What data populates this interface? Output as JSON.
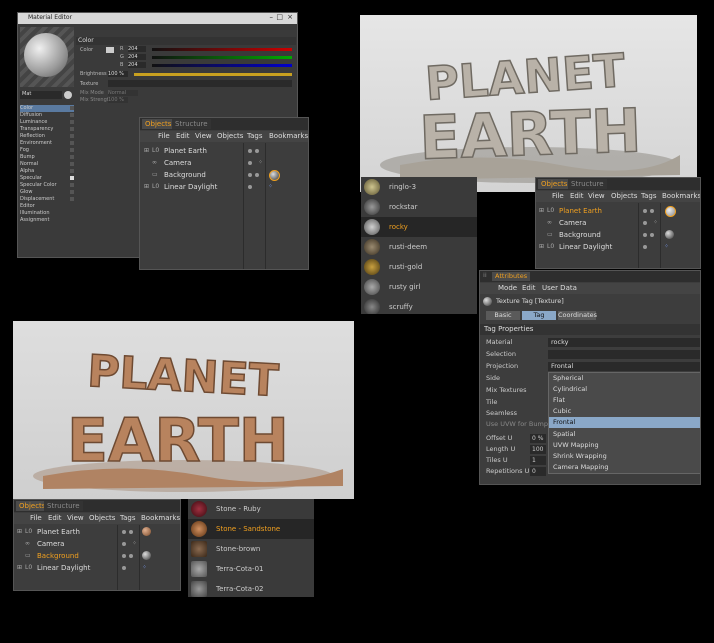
{
  "material_editor": {
    "title": "Material Editor",
    "section_title": "Color",
    "color_label": "Color",
    "channel_labels": [
      "R",
      "G",
      "B"
    ],
    "channel_values": [
      "204",
      "204",
      "204"
    ],
    "brightness_label": "Brightness",
    "brightness_value": "100 %",
    "texture_label": "Texture",
    "mix_mode_label": "Mix Mode",
    "mix_mode_value": "Normal",
    "mix_strength_label": "Mix Strength",
    "mix_strength_value": "100 %",
    "material_name": "Mat",
    "channels": [
      "Color",
      "Diffusion",
      "Luminance",
      "Transparency",
      "Reflection",
      "Environment",
      "Fog",
      "Bump",
      "Normal",
      "Alpha",
      "Specular",
      "Specular Color",
      "Glow",
      "Displacement",
      "Editor",
      "Illumination",
      "Assignment"
    ]
  },
  "objects_panel_1": {
    "tabs": [
      "Objects",
      "Structure"
    ],
    "menu": [
      "File",
      "Edit",
      "View",
      "Objects",
      "Tags",
      "Bookmarks"
    ],
    "objects": [
      "Planet Earth",
      "Camera",
      "Background",
      "Linear Daylight"
    ]
  },
  "objects_panel_2": {
    "tabs": [
      "Objects",
      "Structure"
    ],
    "menu": [
      "File",
      "Edit",
      "View",
      "Objects",
      "Tags",
      "Bookmarks"
    ],
    "objects": [
      "Planet Earth",
      "Camera",
      "Background",
      "Linear Daylight"
    ]
  },
  "objects_panel_3": {
    "tabs": [
      "Objects",
      "Structure"
    ],
    "menu": [
      "File",
      "Edit",
      "View",
      "Objects",
      "Tags",
      "Bookmarks"
    ],
    "objects": [
      "Planet Earth",
      "Camera",
      "Background",
      "Linear Daylight"
    ]
  },
  "material_list_1": {
    "items": [
      "ringlo-3",
      "rockstar",
      "rocky",
      "rusti-deem",
      "rusti-gold",
      "rusty girl",
      "scruffy"
    ],
    "selected": "rocky"
  },
  "material_list_2": {
    "items": [
      "Stone - Ruby",
      "Stone - Sandstone",
      "Stone-brown",
      "Terra-Cota-01",
      "Terra-Cota-02"
    ],
    "selected": "Stone - Sandstone"
  },
  "attributes": {
    "title": "Attributes",
    "menu": [
      "Mode",
      "Edit",
      "User Data"
    ],
    "object_label": "Texture Tag [Texture]",
    "tabs": [
      "Basic",
      "Tag",
      "Coordinates"
    ],
    "section": "Tag Properties",
    "rows": [
      {
        "label": "Material",
        "value": "rocky"
      },
      {
        "label": "Selection",
        "value": ""
      },
      {
        "label": "Projection",
        "value": "Frontal"
      },
      {
        "label": "Side",
        "value": ""
      },
      {
        "label": "Mix Textures",
        "value": ""
      },
      {
        "label": "Tile",
        "value": ""
      },
      {
        "label": "Seamless",
        "value": ""
      },
      {
        "label": "Use UVW for Bump",
        "value": ""
      },
      {
        "label": "Offset U",
        "value": "0 %"
      },
      {
        "label": "Length U",
        "value": "100"
      },
      {
        "label": "Tiles U",
        "value": "1"
      },
      {
        "label": "Repetitions U",
        "value": "0"
      }
    ],
    "projection_options": [
      "Spherical",
      "Cylindrical",
      "Flat",
      "Cubic",
      "Frontal",
      "Spatial",
      "UVW Mapping",
      "Shrink Wrapping",
      "Camera Mapping"
    ],
    "projection_selected": "Frontal"
  },
  "render_text": {
    "line1": "PLANET",
    "line2": "EARTH"
  },
  "colors": {
    "active_tab": "#f0a020",
    "panel_bg": "#3d3d3d",
    "selection": "#7a9cc0",
    "stone_grey": "#b9b2a8",
    "sandstone": "#b8835e"
  }
}
